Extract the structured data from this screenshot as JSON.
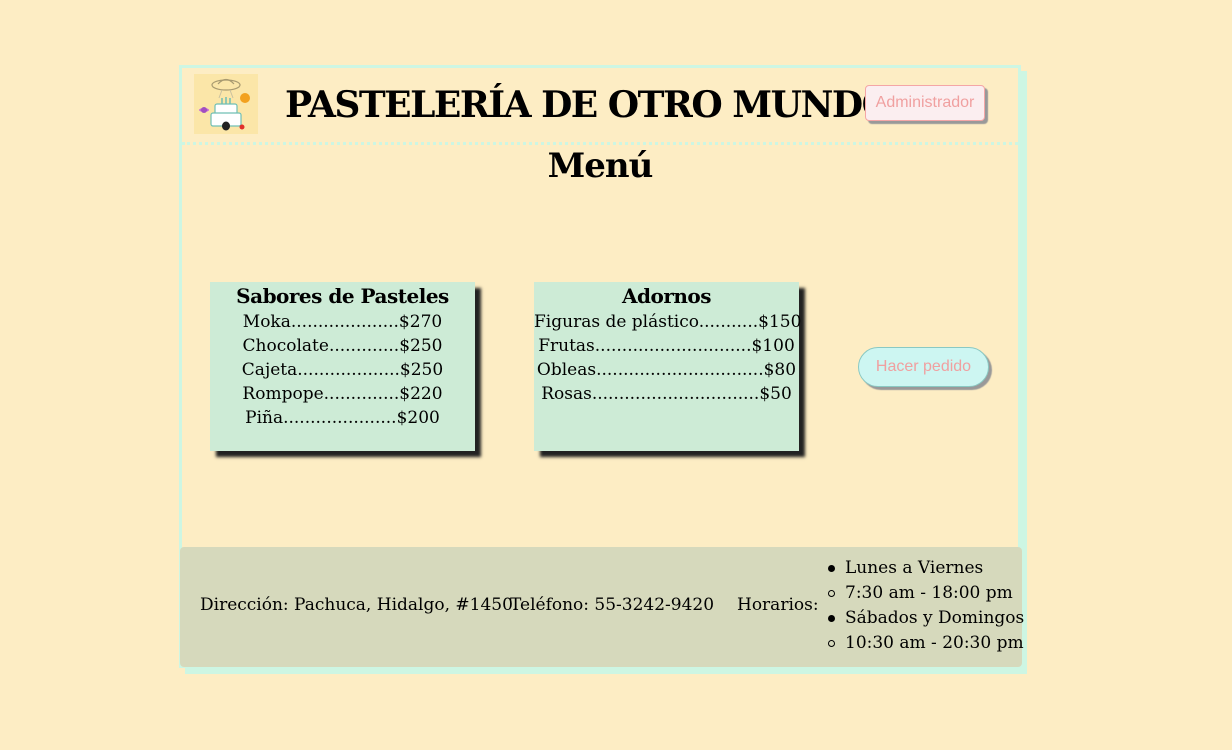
{
  "header": {
    "title": "PASTELERÍA DE OTRO MUNDO",
    "admin_label": "Administrador",
    "logo_icon": "alien-cake-planets-logo"
  },
  "menu": {
    "title": "Menú",
    "sections": [
      {
        "title": "Sabores de Pasteles",
        "items": [
          "Moka....................$270",
          "Chocolate.............$250",
          "Cajeta...................$250",
          "Rompope..............$220",
          "Piña.....................$200"
        ]
      },
      {
        "title": "Adornos",
        "items": [
          "Figuras de plástico...........$150",
          "Frutas.............................$100",
          "Obleas...............................$80",
          "Rosas...............................$50"
        ]
      }
    ],
    "order_label": "Hacer pedido"
  },
  "footer": {
    "address": "Dirección: Pachuca, Hidalgo, #1450.",
    "phone": "Teléfono: 55-3242-9420",
    "hours_label": "Horarios:",
    "hours": [
      {
        "text": "Lunes a Viernes",
        "bullet": "disc"
      },
      {
        "text": "7:30 am - 18:00 pm",
        "bullet": "circle"
      },
      {
        "text": "Sábados y Domingos",
        "bullet": "disc"
      },
      {
        "text": "10:30 am - 20:30 pm",
        "bullet": "circle"
      }
    ]
  },
  "colors": {
    "background": "#fdedc4",
    "frame_border": "#cdf6e3",
    "card_background": "#cdebd6",
    "footer_background": "#d6d9bc",
    "button_text": "#f0a0a0"
  }
}
